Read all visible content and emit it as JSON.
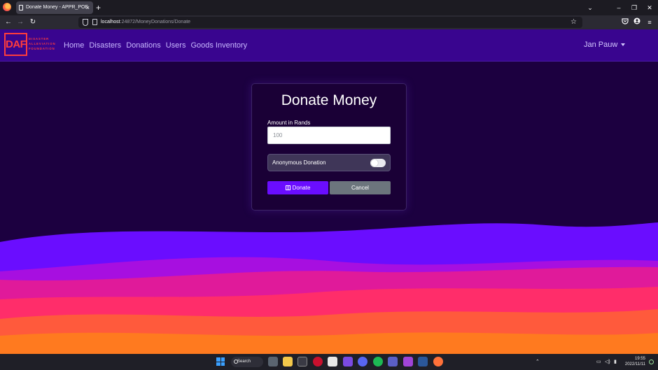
{
  "browser": {
    "tab_title": "Donate Money - APPR_POE",
    "tab_close": "×",
    "new_tab": "+",
    "url_host": "localhost",
    "url_rest": ":24872/MoneyDonations/Donate",
    "controls": {
      "list_all_tabs": "⌄",
      "minimize": "–",
      "restore": "❐",
      "close": "✕"
    },
    "nav": {
      "back": "←",
      "forward": "→",
      "reload": "↻",
      "bookmark_star": "☆",
      "menu": "≡"
    }
  },
  "site": {
    "brand_logo": "DAF",
    "brand_tagline": [
      "DISASTER",
      "ALLEVIATION",
      "FOUNDATION"
    ],
    "brand_color": "#ff3c3c",
    "nav_items": [
      "Home",
      "Disasters",
      "Donations",
      "Users",
      "Goods Inventory"
    ],
    "user_name": "Jan Pauw",
    "navbar_color": "#39058f",
    "background_color": "#1c0040"
  },
  "form": {
    "title": "Donate Money",
    "amount_label": "Amount in Rands",
    "amount_value": "",
    "amount_placeholder": "100",
    "anonymous_label": "Anonymous Donation",
    "anonymous_checked": false,
    "donate_label": "Donate",
    "cancel_label": "Cancel",
    "donate_color": "#6a0dff",
    "cancel_color": "#6c757d"
  },
  "waves": {
    "colors": [
      "#6a0dff",
      "#a70fe0",
      "#e01a9a",
      "#ff2d6a",
      "#ff5a3c",
      "#ff7a1f"
    ]
  },
  "taskbar": {
    "search_label": "Search",
    "time": "19:55",
    "date": "2022/11/11",
    "tray_icons": [
      "chevron-up-icon",
      "network-icon",
      "volume-icon",
      "battery-icon"
    ]
  }
}
